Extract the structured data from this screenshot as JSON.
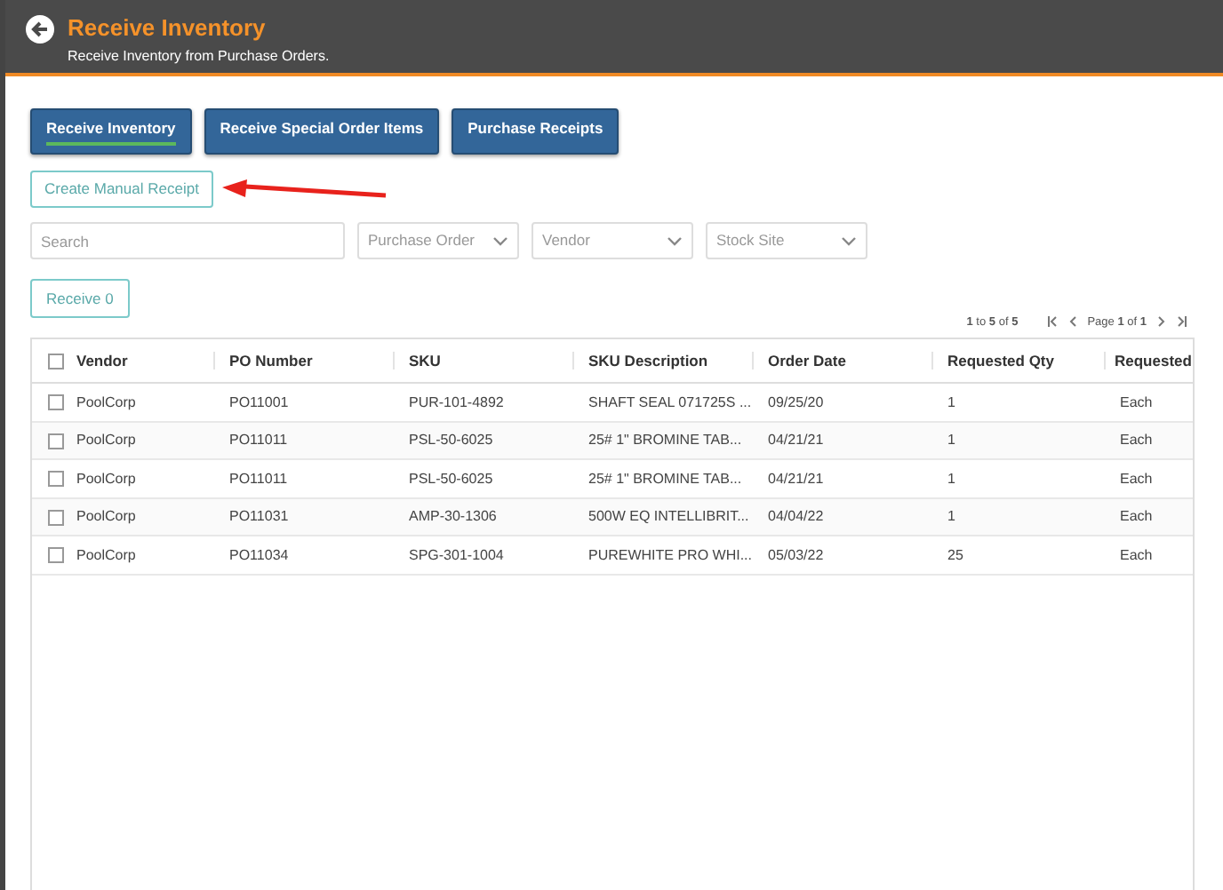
{
  "header": {
    "title": "Receive Inventory",
    "subtitle": "Receive Inventory from Purchase Orders."
  },
  "tabs": [
    {
      "label": "Receive Inventory",
      "selected": true
    },
    {
      "label": "Receive Special Order Items",
      "selected": false
    },
    {
      "label": "Purchase Receipts",
      "selected": false
    }
  ],
  "create_button": "Create Manual Receipt",
  "filters": {
    "search": {
      "placeholder": "Search"
    },
    "dropdowns": [
      {
        "placeholder": "Purchase Order"
      },
      {
        "placeholder": "Vendor"
      },
      {
        "placeholder": "Stock Site"
      }
    ]
  },
  "receive_button": "Receive 0",
  "pagination": {
    "summary": "**1** to **5** of **5**",
    "page": "Page **1** of **1**"
  },
  "table": {
    "columns": [
      "Vendor",
      "PO Number",
      "SKU",
      "SKU Description",
      "Order Date",
      "Requested Qty",
      "Requested"
    ],
    "header_checked": false,
    "rows": [
      {
        "checked": false,
        "cells": [
          "PoolCorp",
          "PO11001",
          "PUR-101-4892",
          "SHAFT SEAL 071725S ...",
          "09/25/20",
          "1",
          "Each"
        ]
      },
      {
        "checked": false,
        "cells": [
          "PoolCorp",
          "PO11011",
          "PSL-50-6025",
          "25# 1\" BROMINE TAB...",
          "04/21/21",
          "1",
          "Each"
        ]
      },
      {
        "checked": false,
        "cells": [
          "PoolCorp",
          "PO11011",
          "PSL-50-6025",
          "25# 1\" BROMINE TAB...",
          "04/21/21",
          "1",
          "Each"
        ]
      },
      {
        "checked": false,
        "cells": [
          "PoolCorp",
          "PO11031",
          "AMP-30-1306",
          "500W EQ INTELLIBRIT...",
          "04/04/22",
          "1",
          "Each"
        ]
      },
      {
        "checked": false,
        "cells": [
          "PoolCorp",
          "PO11034",
          "SPG-301-1004",
          "PUREWHITE PRO WHI...",
          "05/03/22",
          "25",
          "Each"
        ]
      }
    ]
  }
}
